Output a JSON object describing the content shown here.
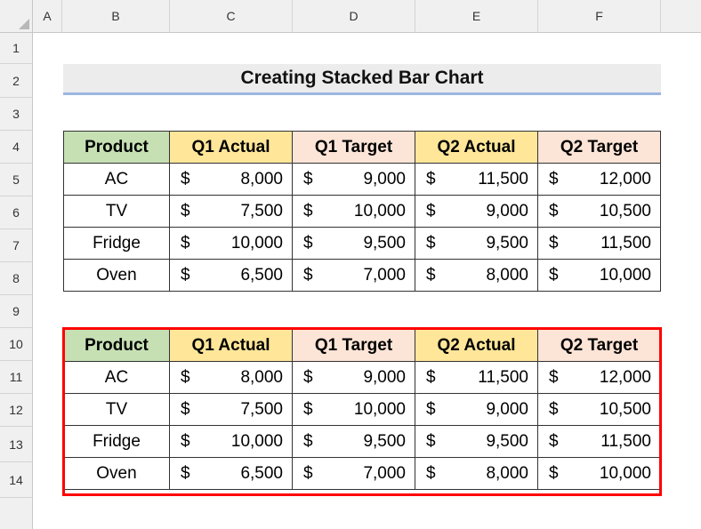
{
  "columns": [
    "A",
    "B",
    "C",
    "D",
    "E",
    "F"
  ],
  "rows": [
    "1",
    "2",
    "3",
    "4",
    "5",
    "6",
    "7",
    "8",
    "9",
    "10",
    "11",
    "12",
    "13",
    "14"
  ],
  "title": "Creating Stacked Bar Chart",
  "headers": {
    "product": "Product",
    "q1a": "Q1 Actual",
    "q1t": "Q1 Target",
    "q2a": "Q2 Actual",
    "q2t": "Q2 Target"
  },
  "currency": "$",
  "table1": [
    {
      "product": "AC",
      "q1a": "8,000",
      "q1t": "9,000",
      "q2a": "11,500",
      "q2t": "12,000"
    },
    {
      "product": "TV",
      "q1a": "7,500",
      "q1t": "10,000",
      "q2a": "9,000",
      "q2t": "10,500"
    },
    {
      "product": "Fridge",
      "q1a": "10,000",
      "q1t": "9,500",
      "q2a": "9,500",
      "q2t": "11,500"
    },
    {
      "product": "Oven",
      "q1a": "6,500",
      "q1t": "7,000",
      "q2a": "8,000",
      "q2t": "10,000"
    }
  ],
  "table2": [
    {
      "product": "AC",
      "q1a": "8,000",
      "q1t": "9,000",
      "q2a": "11,500",
      "q2t": "12,000"
    },
    {
      "product": "TV",
      "q1a": "7,500",
      "q1t": "10,000",
      "q2a": "9,000",
      "q2t": "10,500"
    },
    {
      "product": "Fridge",
      "q1a": "10,000",
      "q1t": "9,500",
      "q2a": "9,500",
      "q2t": "11,500"
    },
    {
      "product": "Oven",
      "q1a": "6,500",
      "q1t": "7,000",
      "q2a": "8,000",
      "q2t": "10,000"
    }
  ],
  "colors": {
    "product_header": "#c6e0b4",
    "actual_header": "#ffe699",
    "target_header": "#fce4d6",
    "selection": "#ff0000"
  }
}
